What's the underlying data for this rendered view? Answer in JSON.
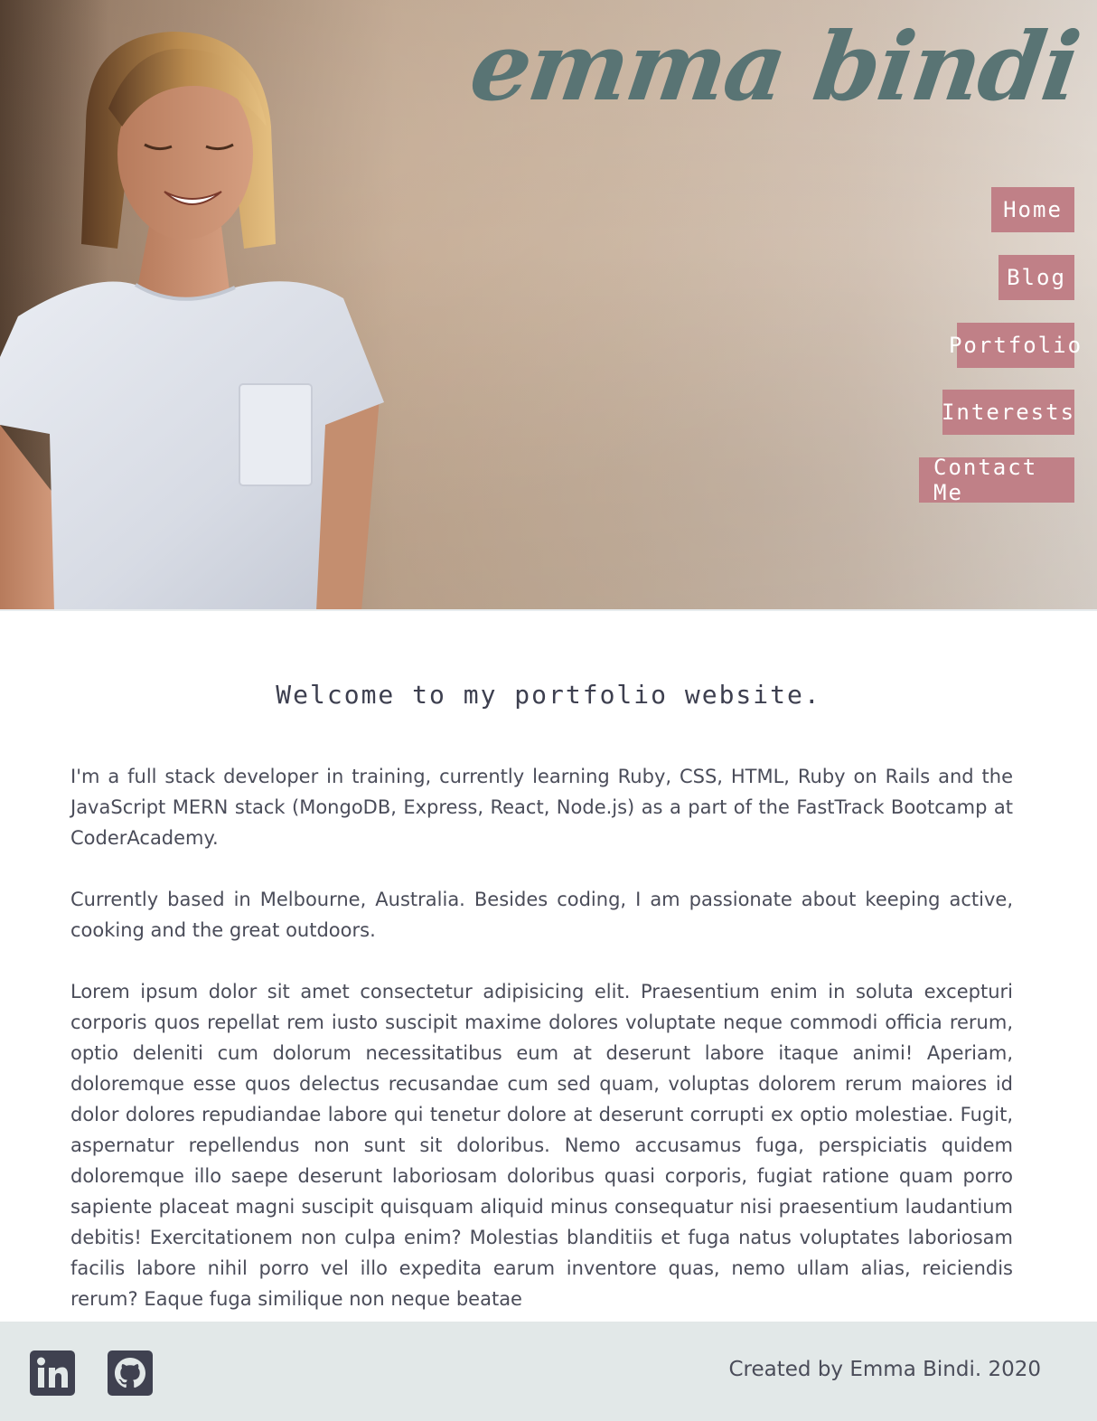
{
  "header": {
    "logo_text": "emma bindi",
    "brand_color": "#597474",
    "nav_color": "#c08087",
    "nav": [
      {
        "label": "Home",
        "icon": null
      },
      {
        "label": "Blog",
        "icon": null
      },
      {
        "label": "Portfolio",
        "icon": null
      },
      {
        "label": "Interests",
        "icon": null
      },
      {
        "label": "Contact Me",
        "icon": null
      }
    ]
  },
  "main": {
    "heading": "Welcome to my portfolio website.",
    "paragraphs": [
      "I'm a full stack developer in training, currently learning Ruby, CSS, HTML, Ruby on Rails and the JavaScript MERN stack (MongoDB, Express, React, Node.js) as a part of the FastTrack Bootcamp at CoderAcademy.",
      "Currently based in Melbourne, Australia. Besides coding, I am passionate about keeping active, cooking and the great outdoors.",
      "Lorem ipsum dolor sit amet consectetur adipisicing elit. Praesentium enim in soluta excepturi corporis quos repellat rem iusto suscipit maxime dolores voluptate neque commodi officia rerum, optio deleniti cum dolorum necessitatibus eum at deserunt labore itaque animi! Aperiam, doloremque esse quos delectus recusandae cum sed quam, voluptas dolorem rerum maiores id dolor dolores repudiandae labore qui tenetur dolore at deserunt corrupti ex optio molestiae. Fugit, aspernatur repellendus non sunt sit doloribus. Nemo accusamus fuga, perspiciatis quidem doloremque illo saepe deserunt laboriosam doloribus quasi corporis, fugiat ratione quam porro sapiente placeat magni suscipit quisquam aliquid minus consequatur nisi praesentium laudantium debitis! Exercitationem non culpa enim? Molestias blanditiis et fuga natus voluptates laboriosam facilis labore nihil porro vel illo expedita earum inventore quas, nemo ullam alias, reiciendis rerum? Eaque fuga similique non neque beatae"
    ]
  },
  "footer": {
    "icons": [
      "linkedin-icon",
      "github-icon"
    ],
    "credit": "Created by Emma Bindi. 2020"
  }
}
